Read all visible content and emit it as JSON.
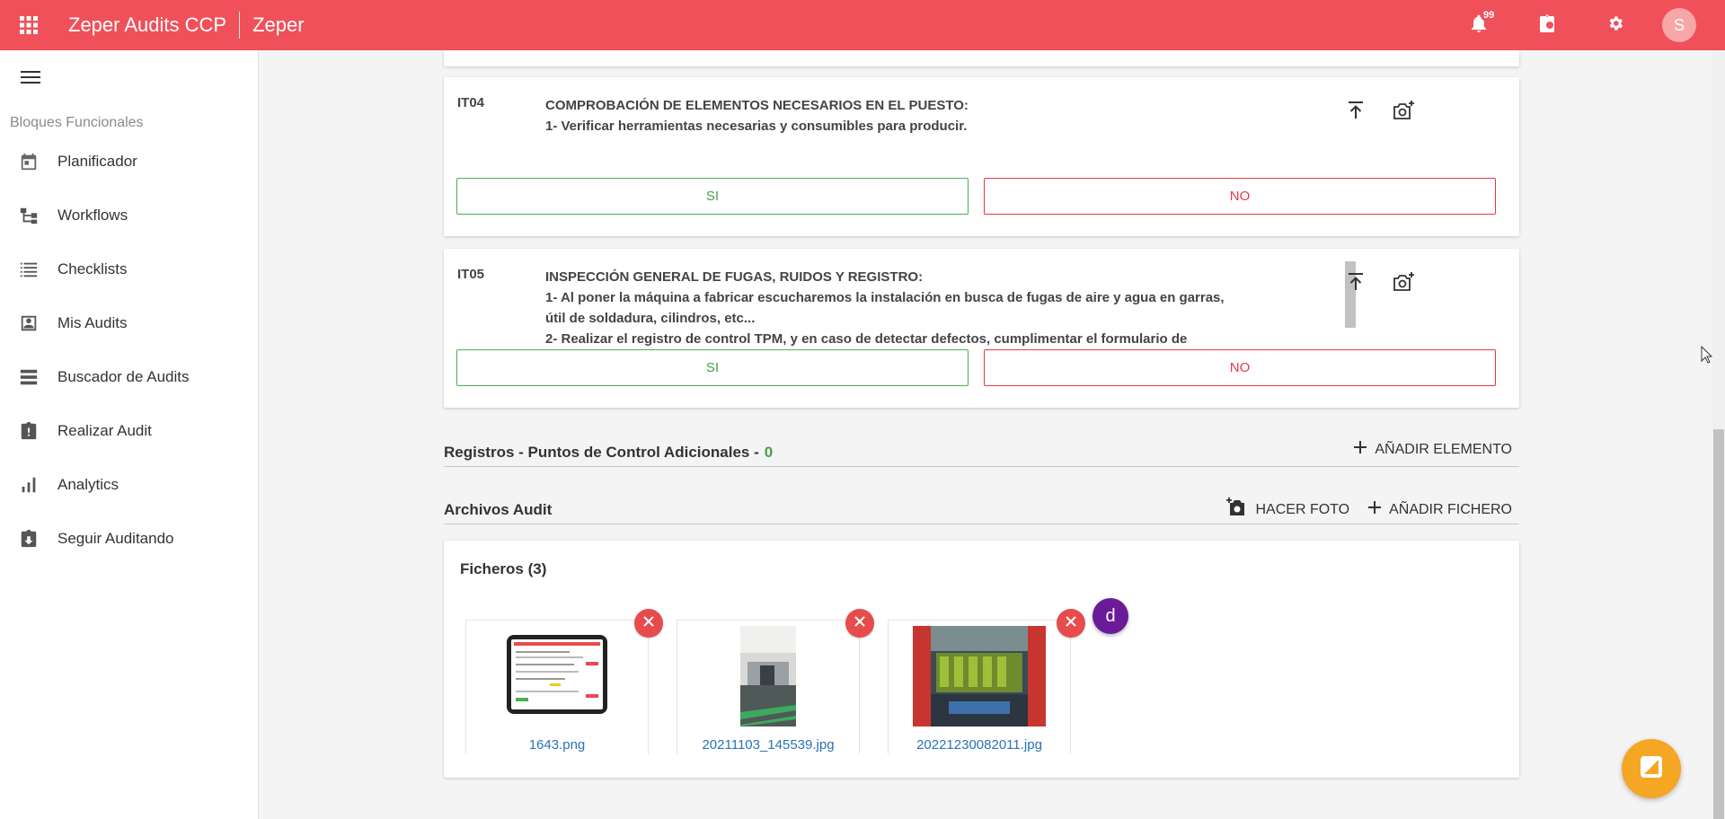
{
  "topbar": {
    "app_title_bold": "Zeper Audits",
    "app_title_light": " CCP",
    "org_name": "Zeper",
    "notification_count": "99",
    "avatar_initial": "S"
  },
  "sidebar": {
    "section_label": "Bloques Funcionales",
    "items": [
      {
        "label": "Planificador",
        "icon": "calendar-icon"
      },
      {
        "label": "Workflows",
        "icon": "workflow-icon"
      },
      {
        "label": "Checklists",
        "icon": "list-icon"
      },
      {
        "label": "Mis Audits",
        "icon": "account-box-icon"
      },
      {
        "label": "Buscador de Audits",
        "icon": "storage-icon"
      },
      {
        "label": "Realizar Audit",
        "icon": "clipboard-alert-icon"
      },
      {
        "label": "Analytics",
        "icon": "bar-chart-icon"
      },
      {
        "label": "Seguir Auditando",
        "icon": "clipboard-download-icon"
      }
    ]
  },
  "questions": [
    {
      "code": "IT04",
      "lines": [
        "COMPROBACIÓN  DE ELEMENTOS NECESARIOS EN EL PUESTO:",
        "1- Verificar herramientas necesarias y consumibles para producir."
      ],
      "yes_label": "SI",
      "no_label": "NO"
    },
    {
      "code": "IT05",
      "lines": [
        "INSPECCIÓN GENERAL DE FUGAS, RUIDOS Y REGISTRO:",
        "1- Al poner la máquina a fabricar escucharemos la instalación en busca de fugas de aire y agua en garras,",
        "útil de soldadura, cilindros, etc...",
        "2- Realizar el registro de control TPM, y en caso de detectar defectos, cumplimentar el formulario de"
      ],
      "yes_label": "SI",
      "no_label": "NO"
    }
  ],
  "registros": {
    "title": "Registros - Puntos de Control Adicionales -",
    "count": "0",
    "add_label": "AÑADIR ELEMENTO"
  },
  "archivos": {
    "title": "Archivos Audit",
    "photo_label": "HACER FOTO",
    "add_file_label": "AÑADIR FICHERO",
    "files_title": "Ficheros (3)",
    "files": [
      {
        "name": "1643.png"
      },
      {
        "name": "20211103_145539.jpg"
      },
      {
        "name": "20221230082011.jpg"
      }
    ],
    "chip_letter": "d"
  },
  "colors": {
    "brand": "#f0505a",
    "yes": "#43a047",
    "no": "#e53945",
    "fab": "#f5a623"
  }
}
